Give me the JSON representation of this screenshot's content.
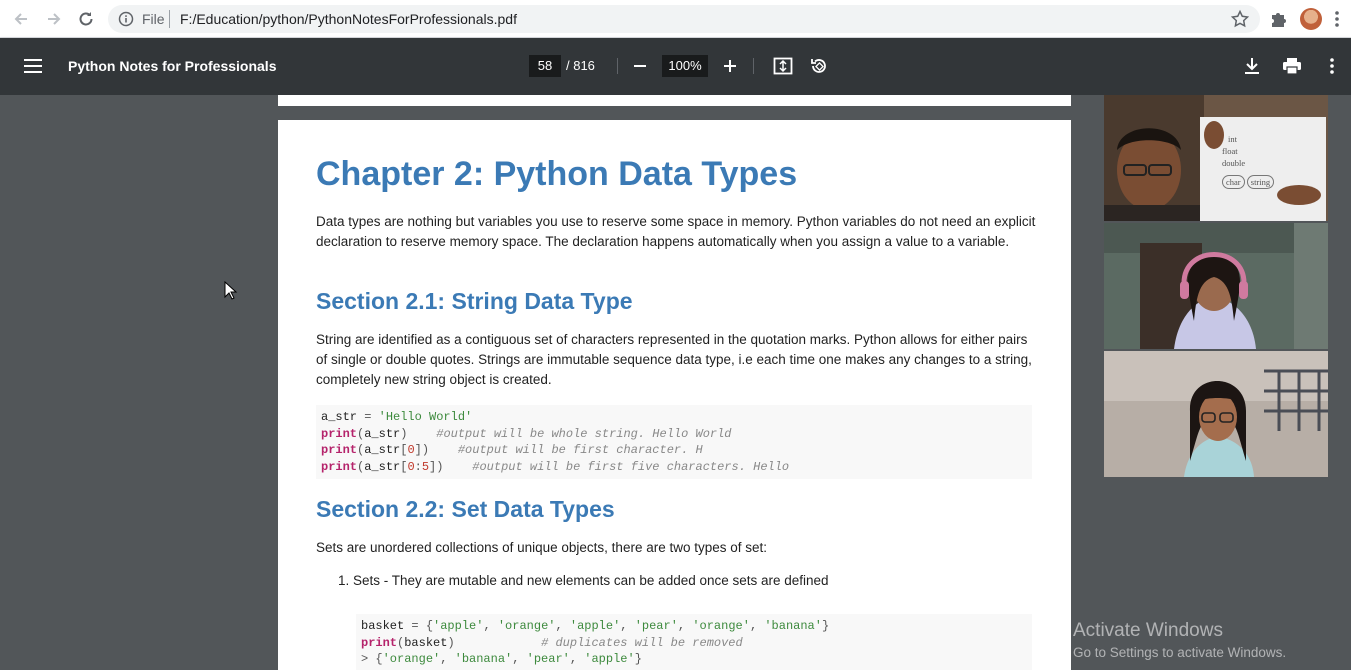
{
  "browser": {
    "omnibox_scheme": "File",
    "url": "F:/Education/python/PythonNotesForProfessionals.pdf"
  },
  "pdf_toolbar": {
    "title": "Python Notes for Professionals",
    "current_page": "58",
    "total_pages": "/ 816",
    "zoom": "100%"
  },
  "page": {
    "chapter_title": "Chapter 2: Python Data Types",
    "intro": "Data types are nothing but variables you use to reserve some space in memory. Python variables do not need an explicit declaration to reserve memory space. The declaration happens automatically when you assign a value to a variable.",
    "section1_title": "Section 2.1: String Data Type",
    "section1_para": "String are identified as a contiguous set of characters represented in the quotation marks. Python allows for either pairs of single or double quotes. Strings are immutable sequence data type, i.e each time one makes any changes to a string, completely new string object is created.",
    "code1": [
      "a_str = 'Hello World'",
      "print(a_str)    #output will be whole string. Hello World",
      "print(a_str[0])    #output will be first character. H",
      "print(a_str[0:5])    #output will be first five characters. Hello"
    ],
    "section2_title": "Section 2.2: Set Data Types",
    "section2_para": "Sets are unordered collections of unique objects, there are two types of set:",
    "list_item_1": "1.  Sets - They are mutable and new elements can be added once sets are defined",
    "code2": [
      "basket = {'apple', 'orange', 'apple', 'pear', 'orange', 'banana'}",
      "print(basket)            # duplicates will be removed",
      "> {'orange', 'banana', 'pear', 'apple'}"
    ]
  },
  "video_panel": {
    "whiteboard_words": [
      "int",
      "float",
      "double",
      "char",
      "string"
    ]
  },
  "watermark": {
    "line1": "Activate Windows",
    "line2": "Go to Settings to activate Windows."
  },
  "colors": {
    "heading_blue": "#3b7ab5",
    "toolbar_bg": "#323639",
    "viewer_bg": "#525659"
  }
}
